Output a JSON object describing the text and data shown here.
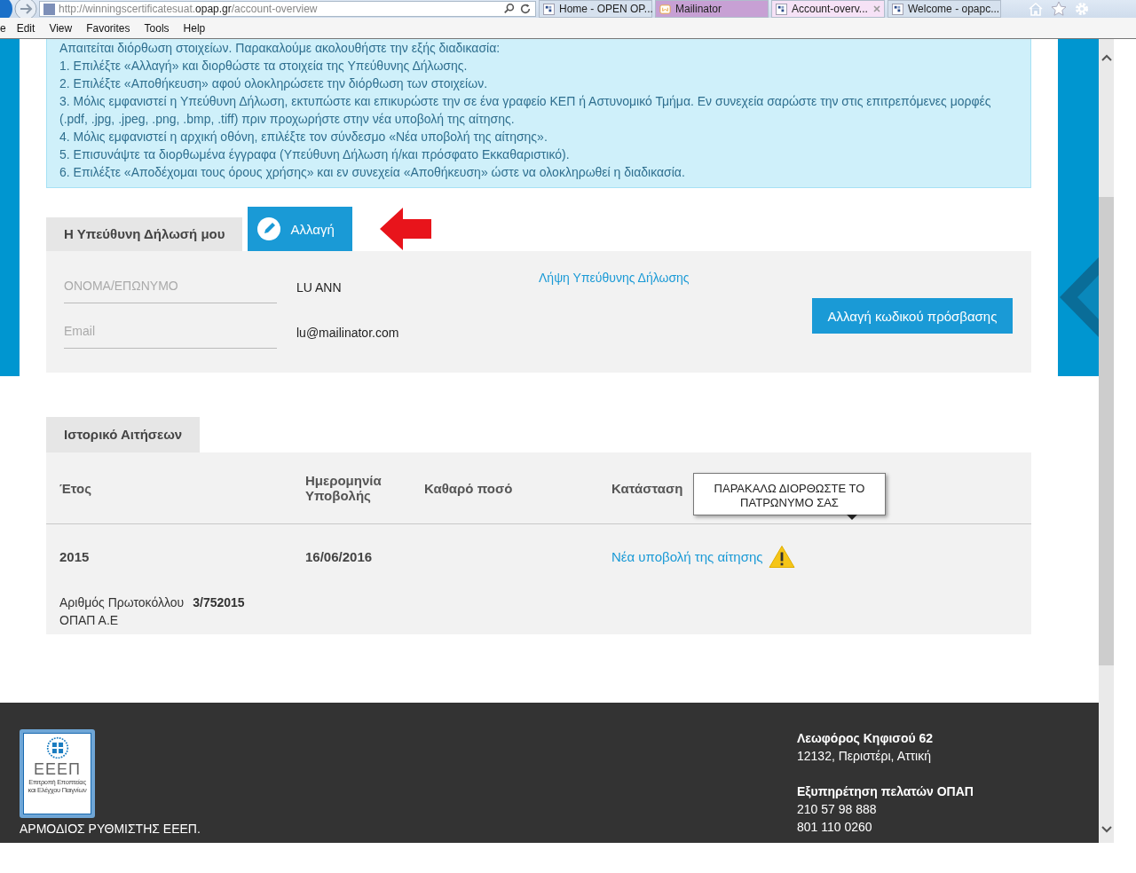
{
  "browser": {
    "url": {
      "prefix": "http://winningscertificatesuat.",
      "domain": "opap.gr",
      "path": "/account-overview"
    },
    "tabs": [
      {
        "title": "Home - OPEN OP...",
        "selected": false,
        "kind": "site"
      },
      {
        "title": "Mailinator",
        "selected": false,
        "kind": "mail"
      },
      {
        "title": "Account-overv...",
        "selected": true,
        "kind": "site"
      },
      {
        "title": "Welcome - opapc...",
        "selected": false,
        "kind": "site"
      }
    ],
    "menu": [
      "e",
      "Edit",
      "View",
      "Favorites",
      "Tools",
      "Help"
    ]
  },
  "notice": {
    "intro": "Απαιτείται διόρθωση στοιχείων. Παρακαλούμε ακολουθήστε την εξής διαδικασία:",
    "steps": [
      "1. Επιλέξτε «Αλλαγή» και διορθώστε τα στοιχεία της Υπεύθυνης Δήλωσης.",
      "2. Επιλέξτε «Αποθήκευση» αφού ολοκληρώσετε την διόρθωση των στοιχείων.",
      "3. Μόλις εμφανιστεί η Υπεύθυνη Δήλωση, εκτυπώστε και επικυρώστε την σε ένα γραφείο ΚΕΠ ή Αστυνομικό Τμήμα. Εν συνεχεία σαρώστε την στις επιτρεπόμενες μορφές (.pdf, .jpg, .jpeg, .png, .bmp, .tiff) πριν προχωρήστε στην νέα υποβολή της αίτησης.",
      "4. Μόλις εμφανιστεί η αρχική οθόνη, επιλέξτε τον σύνδεσμο «Νέα υποβολή της αίτησης».",
      "5. Επισυνάψτε τα διορθωμένα έγγραφα (Υπεύθυνη Δήλωση ή/και πρόσφατο Εκκαθαριστικό).",
      "6. Επιλέξτε «Αποδέχομαι τους όρους χρήσης» και εν συνεχεία «Αποθήκευση» ώστε να ολοκληρωθεί η διαδικασία."
    ]
  },
  "declaration": {
    "tab": "Η Υπεύθυνη Δήλωσή μου",
    "edit_button": "Αλλαγή",
    "fields": [
      {
        "label": "ΟΝΟΜΑ/ΕΠΩΝΥΜΟ",
        "value": "LU ANN"
      },
      {
        "label": "Email",
        "value": "lu@mailinator.com"
      }
    ],
    "download_link": "Λήψη Υπεύθυνης Δήλωσης",
    "password_button": "Αλλαγή κωδικού πρόσβασης"
  },
  "history": {
    "tab": "Ιστορικό Αιτήσεων",
    "columns": [
      "Έτος",
      "Ημερομηνία Υποβολής",
      "Καθαρό ποσό",
      "Κατάσταση"
    ],
    "tooltip": "ΠΑΡΑΚΑΛΩ ΔΙΟΡΘΩΣΤΕ ΤΟ ΠΑΤΡΩΝΥΜΟ ΣΑΣ",
    "rows": [
      {
        "year": "2015",
        "date": "16/06/2016",
        "status_link": "Νέα υποβολή της αίτησης",
        "warning": true,
        "protocol_label": "Αριθμός Πρωτοκόλλου",
        "protocol_number": "3/752015",
        "company": "ΟΠΑΠ Α.Ε"
      }
    ]
  },
  "footer": {
    "logo": {
      "mark": "ΕΕΕΠ",
      "caption": [
        "Επιτροπή Εποπτείας",
        "και Ελέγχου Παιγνίων"
      ]
    },
    "regulator": "ΑΡΜΟΔΙΟΣ ΡΥΘΜΙΣΤΗΣ ΕΕΕΠ.",
    "address": {
      "title": "Λεωφόρος Κηφισού 62",
      "lines": [
        "12132, Περιστέρι, Αττική"
      ]
    },
    "support": {
      "title": "Εξυπηρέτηση πελατών ΟΠΑΠ",
      "lines": [
        "210 57 98 888",
        "801 110 0260"
      ]
    }
  }
}
